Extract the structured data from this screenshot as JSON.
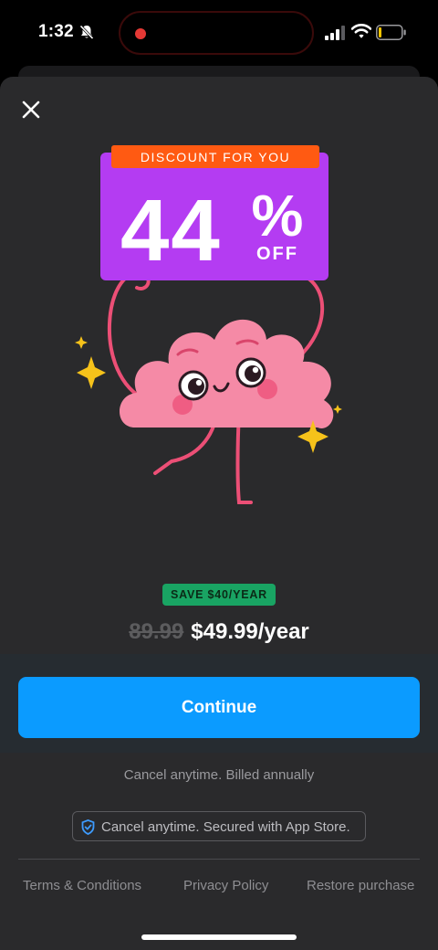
{
  "status_bar": {
    "time": "1:32",
    "icons": [
      "bell-off-icon",
      "signal-icon",
      "wifi-icon",
      "battery-icon"
    ],
    "recording_color": "#e53935"
  },
  "offer": {
    "banner_label": "DISCOUNT FOR YOU",
    "percent": "44",
    "percent_sign": "%",
    "off_label": "OFF",
    "banner_color": "#b43cf2",
    "label_color": "#ff5a12"
  },
  "pricing": {
    "save_badge": "SAVE $40/YEAR",
    "old_price": "89.99",
    "new_price": "$49.99/year"
  },
  "actions": {
    "continue_label": "Continue",
    "billing_note": "Cancel anytime. Billed annually",
    "secure_note": "Cancel anytime. Secured with App Store."
  },
  "footer": {
    "terms": "Terms & Conditions",
    "privacy": "Privacy Policy",
    "restore": "Restore purchase"
  },
  "colors": {
    "accent": "#0b9bff",
    "save_green": "#19a463",
    "sheet_bg": "#2a2a2c",
    "mascot_pink": "#f58aa6"
  }
}
